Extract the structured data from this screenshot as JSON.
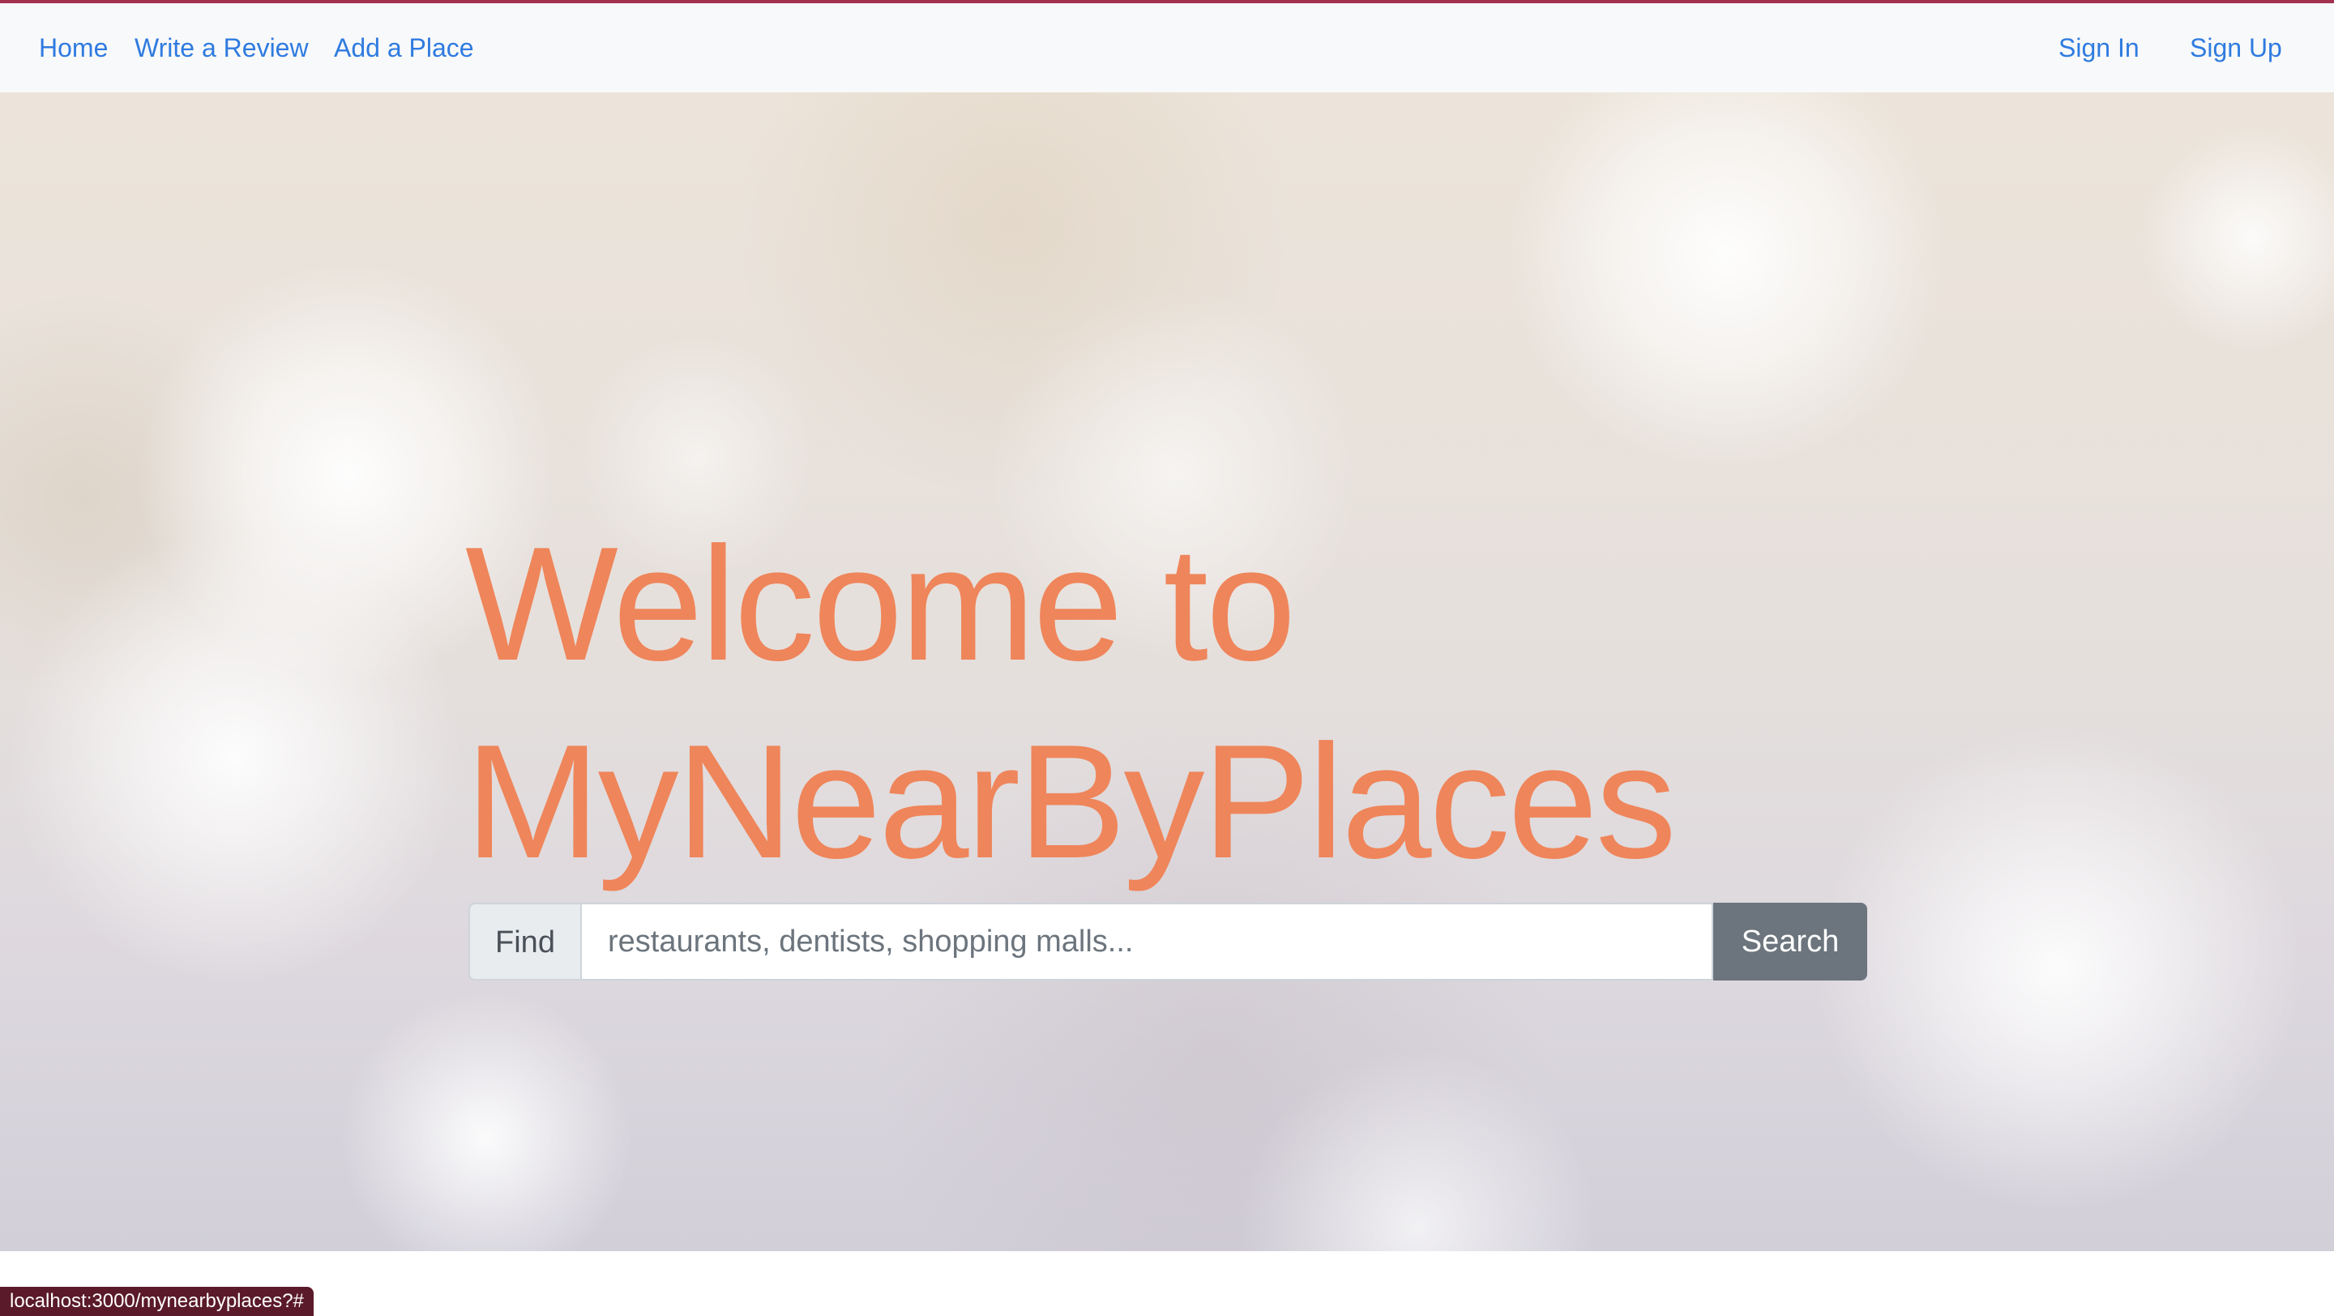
{
  "nav": {
    "home": "Home",
    "write_review": "Write a Review",
    "add_place": "Add a Place",
    "sign_in": "Sign In",
    "sign_up": "Sign Up",
    "link_color": "#2f7be0"
  },
  "hero": {
    "title_line1": "Welcome to",
    "title_line2": "MyNearByPlaces",
    "title_color": "#ef855a"
  },
  "search": {
    "prefix_label": "Find",
    "placeholder": "restaurants, dentists, shopping malls...",
    "value": "",
    "button_label": "Search"
  },
  "status_bar": {
    "url": "localhost:3000/mynearbyplaces?#"
  },
  "colors": {
    "accent_border": "#a3324f",
    "button": "#6c757d"
  }
}
